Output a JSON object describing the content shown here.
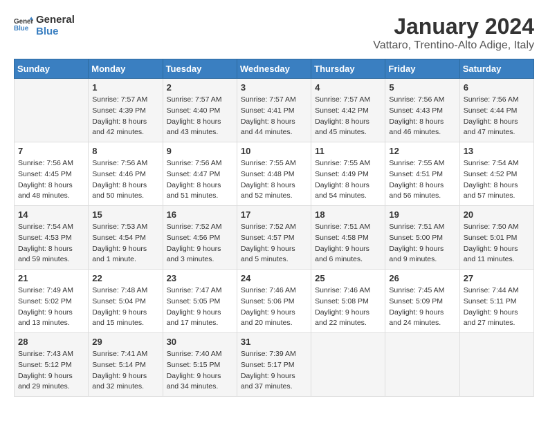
{
  "header": {
    "logo_line1": "General",
    "logo_line2": "Blue",
    "month": "January 2024",
    "location": "Vattaro, Trentino-Alto Adige, Italy"
  },
  "weekdays": [
    "Sunday",
    "Monday",
    "Tuesday",
    "Wednesday",
    "Thursday",
    "Friday",
    "Saturday"
  ],
  "weeks": [
    [
      {
        "day": "",
        "sunrise": "",
        "sunset": "",
        "daylight": ""
      },
      {
        "day": "1",
        "sunrise": "7:57 AM",
        "sunset": "4:39 PM",
        "daylight": "8 hours and 42 minutes."
      },
      {
        "day": "2",
        "sunrise": "7:57 AM",
        "sunset": "4:40 PM",
        "daylight": "8 hours and 43 minutes."
      },
      {
        "day": "3",
        "sunrise": "7:57 AM",
        "sunset": "4:41 PM",
        "daylight": "8 hours and 44 minutes."
      },
      {
        "day": "4",
        "sunrise": "7:57 AM",
        "sunset": "4:42 PM",
        "daylight": "8 hours and 45 minutes."
      },
      {
        "day": "5",
        "sunrise": "7:56 AM",
        "sunset": "4:43 PM",
        "daylight": "8 hours and 46 minutes."
      },
      {
        "day": "6",
        "sunrise": "7:56 AM",
        "sunset": "4:44 PM",
        "daylight": "8 hours and 47 minutes."
      }
    ],
    [
      {
        "day": "7",
        "sunrise": "7:56 AM",
        "sunset": "4:45 PM",
        "daylight": "8 hours and 48 minutes."
      },
      {
        "day": "8",
        "sunrise": "7:56 AM",
        "sunset": "4:46 PM",
        "daylight": "8 hours and 50 minutes."
      },
      {
        "day": "9",
        "sunrise": "7:56 AM",
        "sunset": "4:47 PM",
        "daylight": "8 hours and 51 minutes."
      },
      {
        "day": "10",
        "sunrise": "7:55 AM",
        "sunset": "4:48 PM",
        "daylight": "8 hours and 52 minutes."
      },
      {
        "day": "11",
        "sunrise": "7:55 AM",
        "sunset": "4:49 PM",
        "daylight": "8 hours and 54 minutes."
      },
      {
        "day": "12",
        "sunrise": "7:55 AM",
        "sunset": "4:51 PM",
        "daylight": "8 hours and 56 minutes."
      },
      {
        "day": "13",
        "sunrise": "7:54 AM",
        "sunset": "4:52 PM",
        "daylight": "8 hours and 57 minutes."
      }
    ],
    [
      {
        "day": "14",
        "sunrise": "7:54 AM",
        "sunset": "4:53 PM",
        "daylight": "8 hours and 59 minutes."
      },
      {
        "day": "15",
        "sunrise": "7:53 AM",
        "sunset": "4:54 PM",
        "daylight": "9 hours and 1 minute."
      },
      {
        "day": "16",
        "sunrise": "7:52 AM",
        "sunset": "4:56 PM",
        "daylight": "9 hours and 3 minutes."
      },
      {
        "day": "17",
        "sunrise": "7:52 AM",
        "sunset": "4:57 PM",
        "daylight": "9 hours and 5 minutes."
      },
      {
        "day": "18",
        "sunrise": "7:51 AM",
        "sunset": "4:58 PM",
        "daylight": "9 hours and 6 minutes."
      },
      {
        "day": "19",
        "sunrise": "7:51 AM",
        "sunset": "5:00 PM",
        "daylight": "9 hours and 9 minutes."
      },
      {
        "day": "20",
        "sunrise": "7:50 AM",
        "sunset": "5:01 PM",
        "daylight": "9 hours and 11 minutes."
      }
    ],
    [
      {
        "day": "21",
        "sunrise": "7:49 AM",
        "sunset": "5:02 PM",
        "daylight": "9 hours and 13 minutes."
      },
      {
        "day": "22",
        "sunrise": "7:48 AM",
        "sunset": "5:04 PM",
        "daylight": "9 hours and 15 minutes."
      },
      {
        "day": "23",
        "sunrise": "7:47 AM",
        "sunset": "5:05 PM",
        "daylight": "9 hours and 17 minutes."
      },
      {
        "day": "24",
        "sunrise": "7:46 AM",
        "sunset": "5:06 PM",
        "daylight": "9 hours and 20 minutes."
      },
      {
        "day": "25",
        "sunrise": "7:46 AM",
        "sunset": "5:08 PM",
        "daylight": "9 hours and 22 minutes."
      },
      {
        "day": "26",
        "sunrise": "7:45 AM",
        "sunset": "5:09 PM",
        "daylight": "9 hours and 24 minutes."
      },
      {
        "day": "27",
        "sunrise": "7:44 AM",
        "sunset": "5:11 PM",
        "daylight": "9 hours and 27 minutes."
      }
    ],
    [
      {
        "day": "28",
        "sunrise": "7:43 AM",
        "sunset": "5:12 PM",
        "daylight": "9 hours and 29 minutes."
      },
      {
        "day": "29",
        "sunrise": "7:41 AM",
        "sunset": "5:14 PM",
        "daylight": "9 hours and 32 minutes."
      },
      {
        "day": "30",
        "sunrise": "7:40 AM",
        "sunset": "5:15 PM",
        "daylight": "9 hours and 34 minutes."
      },
      {
        "day": "31",
        "sunrise": "7:39 AM",
        "sunset": "5:17 PM",
        "daylight": "9 hours and 37 minutes."
      },
      {
        "day": "",
        "sunrise": "",
        "sunset": "",
        "daylight": ""
      },
      {
        "day": "",
        "sunrise": "",
        "sunset": "",
        "daylight": ""
      },
      {
        "day": "",
        "sunrise": "",
        "sunset": "",
        "daylight": ""
      }
    ]
  ]
}
